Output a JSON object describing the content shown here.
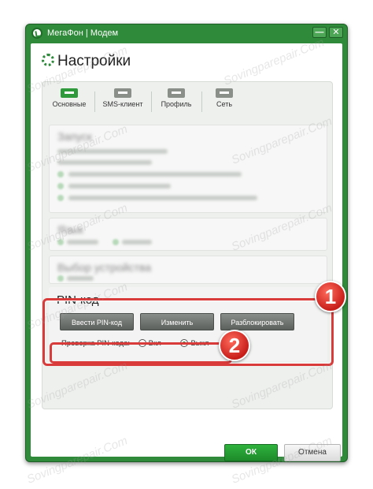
{
  "window": {
    "title": "МегаФон | Модем",
    "min_glyph": "—",
    "close_glyph": "✕"
  },
  "page": {
    "heading": "Настройки"
  },
  "tabs": [
    {
      "label": "Основные",
      "active": true
    },
    {
      "label": "SMS-клиент",
      "active": false
    },
    {
      "label": "Профиль",
      "active": false
    },
    {
      "label": "Сеть",
      "active": false
    }
  ],
  "blurred_sections": {
    "launch_title": "Запуск",
    "language_title": "Язык",
    "device_title": "Выбор устройства"
  },
  "pin": {
    "title": "PIN-код",
    "enter_button": "Ввести PIN-код",
    "change_button": "Изменить",
    "unlock_button": "Разблокировать",
    "check_label": "Проверка PIN-кода:",
    "on_label": "Вкл",
    "off_label": "Выкл",
    "selected": "off"
  },
  "badges": {
    "one": "1",
    "two": "2"
  },
  "footer": {
    "ok": "ОК",
    "cancel": "Отмена"
  },
  "watermark": "Sovingparepair.Com",
  "colors": {
    "window_green": "#2f8a3a",
    "highlight_red": "#d93a3a",
    "ok_green": "#1d8a2a"
  }
}
